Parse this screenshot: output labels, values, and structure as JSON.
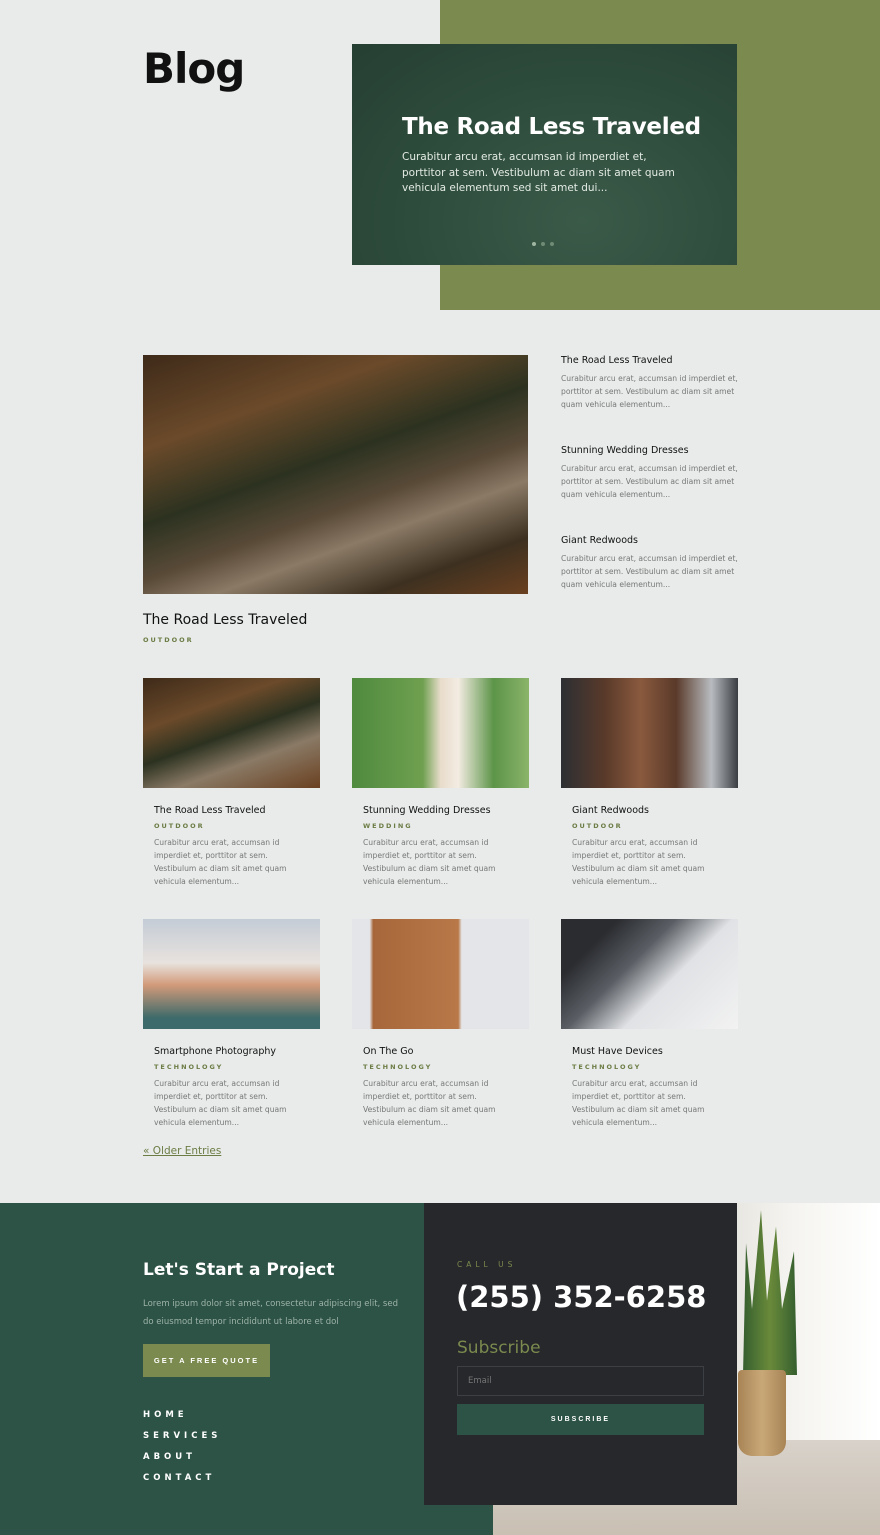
{
  "page": {
    "title": "Blog"
  },
  "hero": {
    "title": "The Road Less Traveled",
    "excerpt": "Curabitur arcu erat, accumsan id imperdiet et, porttitor at sem. Vestibulum ac diam sit amet quam vehicula elementum sed sit amet dui...",
    "slides": 3,
    "active_slide": 1
  },
  "featured": {
    "title": "The Road Less Traveled",
    "tag": "OUTDOOR"
  },
  "sidebar_posts": [
    {
      "title": "The Road Less Traveled",
      "excerpt": "Curabitur arcu erat, accumsan id imperdiet et, porttitor at sem. Vestibulum ac diam sit amet quam vehicula elementum..."
    },
    {
      "title": "Stunning Wedding Dresses",
      "excerpt": "Curabitur arcu erat, accumsan id imperdiet et, porttitor at sem. Vestibulum ac diam sit amet quam vehicula elementum..."
    },
    {
      "title": "Giant Redwoods",
      "excerpt": "Curabitur arcu erat, accumsan id imperdiet et, porttitor at sem. Vestibulum ac diam sit amet quam vehicula elementum..."
    }
  ],
  "posts": [
    {
      "title": "The Road Less Traveled",
      "tag": "OUTDOOR",
      "excerpt": "Curabitur arcu erat, accumsan id imperdiet et, porttitor at sem. Vestibulum ac diam sit amet quam vehicula elementum..."
    },
    {
      "title": "Stunning Wedding Dresses",
      "tag": "WEDDING",
      "excerpt": "Curabitur arcu erat, accumsan id imperdiet et, porttitor at sem. Vestibulum ac diam sit amet quam vehicula elementum..."
    },
    {
      "title": "Giant Redwoods",
      "tag": "OUTDOOR",
      "excerpt": "Curabitur arcu erat, accumsan id imperdiet et, porttitor at sem. Vestibulum ac diam sit amet quam vehicula elementum..."
    },
    {
      "title": "Smartphone Photography",
      "tag": "TECHNOLOGY",
      "excerpt": "Curabitur arcu erat, accumsan id imperdiet et, porttitor at sem. Vestibulum ac diam sit amet quam vehicula elementum..."
    },
    {
      "title": "On The Go",
      "tag": "TECHNOLOGY",
      "excerpt": "Curabitur arcu erat, accumsan id imperdiet et, porttitor at sem. Vestibulum ac diam sit amet quam vehicula elementum..."
    },
    {
      "title": "Must Have Devices",
      "tag": "TECHNOLOGY",
      "excerpt": "Curabitur arcu erat, accumsan id imperdiet et, porttitor at sem. Vestibulum ac diam sit amet quam vehicula elementum..."
    }
  ],
  "pagination": {
    "older": "« Older Entries"
  },
  "footer": {
    "title": "Let's Start a Project",
    "text": "Lorem ipsum dolor sit amet, consectetur adipiscing elit, sed do eiusmod tempor incididunt ut labore et dol",
    "quote_button": "GET A FREE QUOTE",
    "nav": [
      "HOME",
      "SERVICES",
      "ABOUT",
      "CONTACT"
    ],
    "call_label": "CALL US",
    "phone": "(255) 352-6258",
    "subscribe_title": "Subscribe",
    "email_placeholder": "Email",
    "subscribe_button": "SUBSCRIBE"
  },
  "colors": {
    "accent": "#7b8a4e",
    "dark_green": "#2d5246",
    "panel": "#26282b",
    "background": "#e8ebe9"
  }
}
